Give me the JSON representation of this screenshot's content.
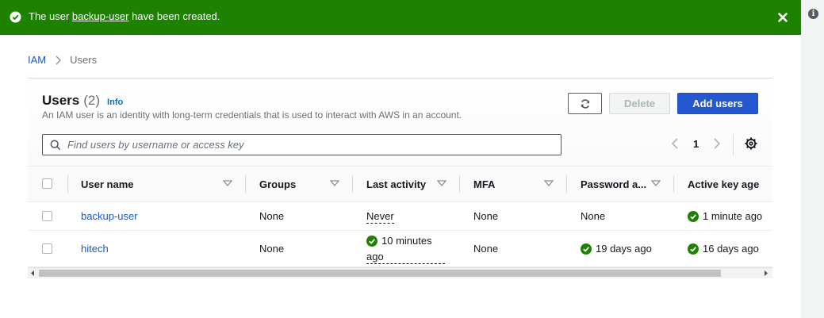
{
  "flash": {
    "prefix": "The user ",
    "user_link": "backup-user",
    "suffix": " have been created."
  },
  "breadcrumb": {
    "root": "IAM",
    "current": "Users"
  },
  "panel": {
    "title": "Users",
    "count": "(2)",
    "info": "Info",
    "description": "An IAM user is an identity with long-term credentials that is used to interact with AWS in an account."
  },
  "buttons": {
    "delete": "Delete",
    "add": "Add users"
  },
  "search": {
    "placeholder": "Find users by username or access key",
    "value": ""
  },
  "pagination": {
    "current_page": "1"
  },
  "table": {
    "columns": [
      "User name",
      "Groups",
      "Last activity",
      "MFA",
      "Password a...",
      "Active key age"
    ],
    "rows": [
      {
        "user": "backup-user",
        "groups": "None",
        "last_activity": "Never",
        "mfa": "None",
        "password_age": "None",
        "key_age": "1 minute ago"
      },
      {
        "user": "hitech",
        "groups": "None",
        "last_activity_line1": "10 minutes",
        "last_activity_line2": "ago",
        "mfa": "None",
        "password_age": "19 days ago",
        "key_age": "16 days ago"
      }
    ]
  },
  "icons": {
    "flash_status": "success-check-icon",
    "close": "close-icon",
    "info": "info-icon",
    "refresh": "refresh-icon",
    "search": "search-icon",
    "settings": "gear-icon",
    "status_ok": "success-check-icon"
  },
  "colors": {
    "flash_bg": "#1d8102",
    "primary": "#2558d0",
    "link": "#1a57c4",
    "success": "#1d8102"
  }
}
